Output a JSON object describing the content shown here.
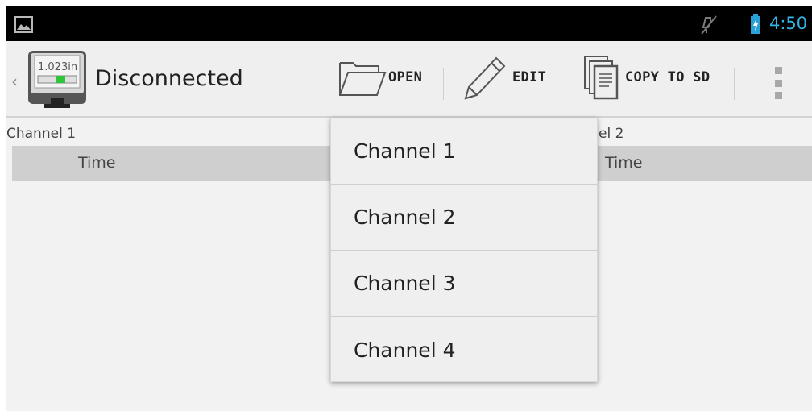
{
  "status_bar": {
    "time": "4:50",
    "icons": [
      "gallery-icon",
      "mute-icon",
      "battery-charging-icon"
    ],
    "accent_color": "#33b5e5"
  },
  "action_bar": {
    "title": "Disconnected",
    "app_icon_reading": "1.023in",
    "actions": {
      "open": "OPEN",
      "edit": "EDIT",
      "copy": "COPY TO SD"
    },
    "icons": [
      "folder-open-icon",
      "pencil-icon",
      "copy-icon",
      "overflow-menu-icon"
    ]
  },
  "content": {
    "channel1_label": "Channel 1",
    "channel2_label_partial": "el 2",
    "col1_header": "Time",
    "col2_header": "Time"
  },
  "dropdown": {
    "items": [
      "Channel 1",
      "Channel 2",
      "Channel 3",
      "Channel 4"
    ]
  }
}
